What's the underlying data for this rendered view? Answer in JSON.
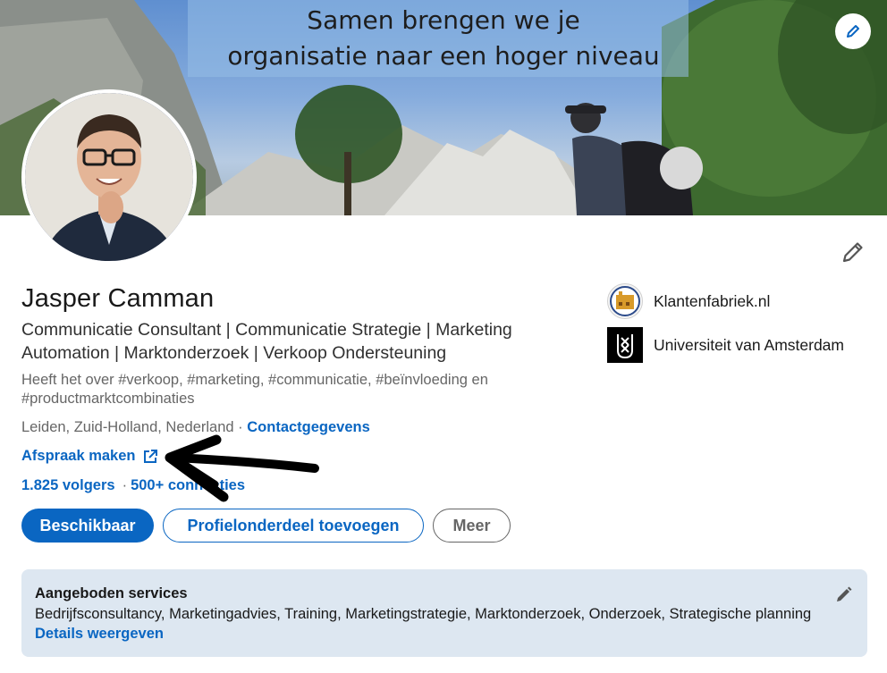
{
  "banner": {
    "line1": "Samen brengen we je",
    "line2": "organisatie naar een hoger niveau"
  },
  "profile": {
    "name": "Jasper Camman",
    "headline": "Communicatie Consultant | Communicatie Strategie | Marketing Automation | Marktonderzoek | Verkoop Ondersteuning",
    "hashtags": "Heeft het over #verkoop, #marketing, #communicatie, #beïnvloeding en #productmarktcombinaties",
    "location": "Leiden, Zuid-Holland, Nederland",
    "location_sep": " · ",
    "contact_link": "Contactgegevens",
    "appointment_link": "Afspraak maken",
    "followers": "1.825 volgers",
    "stats_sep": "·",
    "connections": "500+ connecties"
  },
  "buttons": {
    "available": "Beschikbaar",
    "add_section": "Profielonderdeel toevoegen",
    "more": "Meer"
  },
  "companies": [
    {
      "name": "Klantenfabriek.nl",
      "icon": "klantenfabriek-logo"
    },
    {
      "name": "Universiteit van Amsterdam",
      "icon": "uva-logo"
    }
  ],
  "services": {
    "title": "Aangeboden services",
    "list": "Bedrijfsconsultancy, Marketingadvies, Training, Marketingstrategie, Marktonderzoek, Onderzoek, Strategische planning",
    "details_link": "Details weergeven"
  },
  "colors": {
    "accent": "#0a66c2",
    "services_bg": "#dde7f1",
    "muted_text": "#666666"
  }
}
